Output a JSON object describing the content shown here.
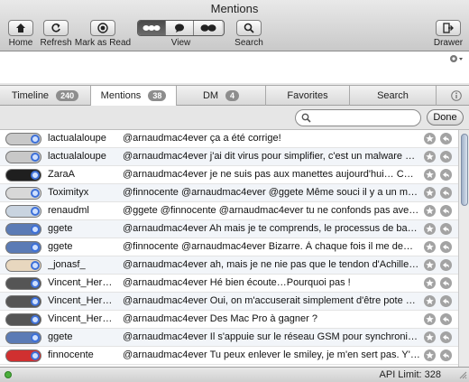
{
  "window": {
    "title": "Mentions"
  },
  "toolbar": {
    "home_label": "Home",
    "refresh_label": "Refresh",
    "mark_as_read_label": "Mark as Read",
    "view_label": "View",
    "search_label": "Search",
    "drawer_label": "Drawer"
  },
  "tabs": [
    {
      "label": "Timeline",
      "badge": "240"
    },
    {
      "label": "Mentions",
      "badge": "38"
    },
    {
      "label": "DM",
      "badge": "4"
    },
    {
      "label": "Favorites"
    },
    {
      "label": "Search"
    }
  ],
  "search": {
    "value": "",
    "done_label": "Done"
  },
  "rows": [
    {
      "user": "lactualaloupe",
      "text": "@arnaudmac4ever ça a été corrige!"
    },
    {
      "user": "lactualaloupe",
      "text": "@arnaudmac4ever j'ai dit virus pour simplifier, c'est un malware mai…"
    },
    {
      "user": "ZaraA",
      "text": "@arnaudmac4ever je ne suis pas aux manettes aujourd'hui… CC @la…"
    },
    {
      "user": "Toximityx",
      "text": "@finnocente @arnaudmac4ever @ggete Même souci il y a un momen…"
    },
    {
      "user": "renaudml",
      "text": "@ggete @finnocente @arnaudmac4ever tu ne confonds pas avec ton…"
    },
    {
      "user": "ggete",
      "text": "@arnaudmac4ever Ah mais je te comprends, le processus de bascul…"
    },
    {
      "user": "ggete",
      "text": "@finnocente @arnaudmac4ever Bizarre. À chaque fois il me demand…"
    },
    {
      "user": "_jonasf_",
      "text": "@arnaudmac4ever ah, mais je ne nie pas que le tendon d'Achille exi…"
    },
    {
      "user": "Vincent_Herm…",
      "text": "@arnaudmac4ever Hé bien écoute…Pourquoi pas !"
    },
    {
      "user": "Vincent_Herm…",
      "text": "@arnaudmac4ever Oui, on m'accuserait simplement d'être pote avec…"
    },
    {
      "user": "Vincent_Herm…",
      "text": "@arnaudmac4ever Des Mac Pro à gagner ?"
    },
    {
      "user": "ggete",
      "text": "@arnaudmac4ever Il s'appuie sur le réseau GSM pour synchroniser l'…"
    },
    {
      "user": "finnocente",
      "text": "@arnaudmac4ever Tu peux enlever le smiley, je m'en sert pas. Y'a ri…"
    }
  ],
  "status": {
    "api_limit": "API Limit: 328"
  }
}
